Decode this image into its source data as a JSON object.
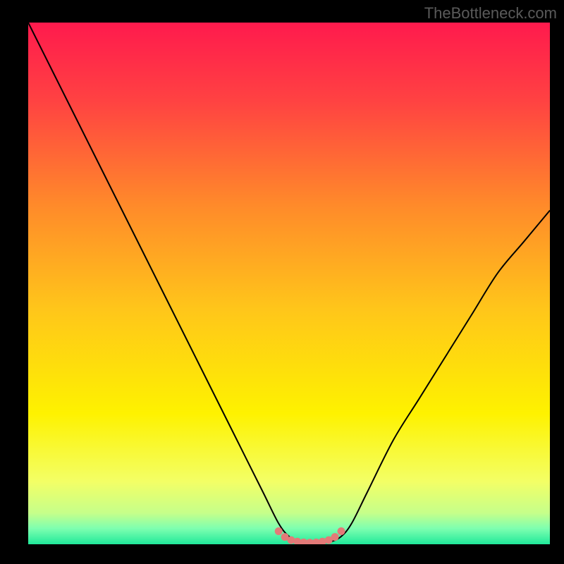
{
  "watermark": "TheBottleneck.com",
  "chart_data": {
    "type": "line",
    "title": "",
    "xlabel": "",
    "ylabel": "",
    "xlim": [
      0,
      100
    ],
    "ylim": [
      0,
      100
    ],
    "grid": false,
    "legend": false,
    "curve": {
      "x": [
        0,
        5,
        10,
        15,
        20,
        25,
        30,
        35,
        40,
        45,
        48,
        50,
        52,
        54,
        56,
        58,
        60,
        62,
        65,
        70,
        75,
        80,
        85,
        90,
        95,
        100
      ],
      "y": [
        100,
        90,
        80,
        70,
        60,
        50,
        40,
        30,
        20,
        10,
        4,
        1.5,
        0.5,
        0.3,
        0.3,
        0.5,
        1.5,
        4,
        10,
        20,
        28,
        36,
        44,
        52,
        58,
        64
      ]
    },
    "optimal_marker": {
      "x": [
        48,
        49.2,
        50.4,
        51.6,
        52.8,
        54,
        55.2,
        56.4,
        57.6,
        58.8,
        60
      ],
      "y": [
        2.5,
        1.4,
        0.8,
        0.5,
        0.35,
        0.3,
        0.35,
        0.5,
        0.8,
        1.4,
        2.5
      ]
    },
    "gradient_stops": [
      {
        "offset": 0.0,
        "color": "#ff1a4d"
      },
      {
        "offset": 0.15,
        "color": "#ff4242"
      },
      {
        "offset": 0.35,
        "color": "#ff8a2a"
      },
      {
        "offset": 0.55,
        "color": "#ffc61a"
      },
      {
        "offset": 0.75,
        "color": "#fef200"
      },
      {
        "offset": 0.88,
        "color": "#f3ff66"
      },
      {
        "offset": 0.94,
        "color": "#c6ff8a"
      },
      {
        "offset": 0.97,
        "color": "#7dffb0"
      },
      {
        "offset": 1.0,
        "color": "#20e89a"
      }
    ],
    "curve_color": "#000000",
    "marker_color": "#e37a78"
  }
}
